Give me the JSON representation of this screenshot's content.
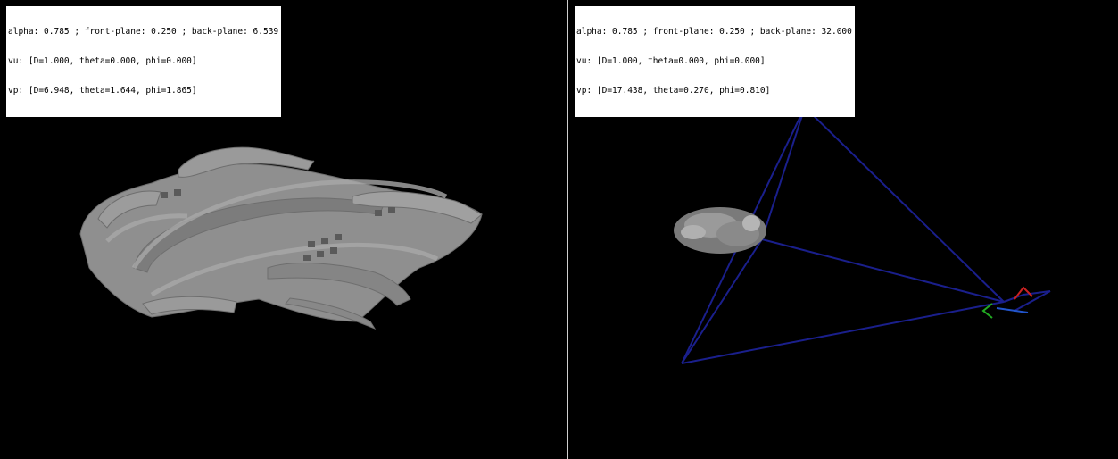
{
  "left_view": {
    "alpha_line": "alpha: 0.785 ; front-plane: 0.250 ; back-plane: 6.539",
    "vu_line": "vu: [D=1.000, theta=0.000, phi=0.000]",
    "vp_line": "vp: [D=6.948, theta=1.644, phi=1.865]",
    "object_color": "#8c8c8c"
  },
  "right_view": {
    "alpha_line": "alpha: 0.785 ; front-plane: 0.250 ; back-plane: 32.000",
    "vu_line": "vu: [D=1.000, theta=0.000, phi=0.000]",
    "vp_line": "vp: [D=17.438, theta=0.270, phi=0.810]",
    "frustum_color": "#1a1f8c",
    "axis_colors": {
      "x": "#cc2222",
      "y": "#22aa22",
      "z": "#2255cc"
    }
  }
}
